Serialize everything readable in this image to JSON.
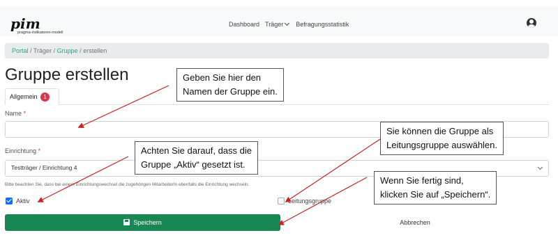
{
  "header": {
    "logo_text": "pim",
    "logo_subtitle": "pragma-indikatoren-modell",
    "nav": [
      "Dashboard",
      "Träger",
      "Befragungsstatistik"
    ]
  },
  "breadcrumb": {
    "items": [
      "Portal",
      "Träger",
      "Gruppe",
      "erstellen"
    ],
    "separator": "/"
  },
  "page": {
    "title": "Gruppe erstellen",
    "tab_label": "Allgemein",
    "tab_badge": "1"
  },
  "form": {
    "name_label": "Name",
    "required_mark": "*",
    "name_value": "",
    "einrichtung_label": "Einrichtung",
    "einrichtung_value": "Testträger / Einrichtung 4",
    "hint": "Bitte beachten Sie, dass bei einem Einrichtungswechsel die zugehörigen MitarbeiterIn ebenfalls die Einrichtung wechseln.",
    "aktiv_label": "Aktiv",
    "aktiv_checked": true,
    "leitung_label": "Leitungsgruppe",
    "leitung_checked": false,
    "save_label": "Speichern",
    "cancel_label": "Abbrechen"
  },
  "callouts": {
    "name": [
      "Geben Sie hier den",
      "Namen der Gruppe ein."
    ],
    "aktiv": [
      "Achten Sie darauf, dass die",
      "Gruppe „Aktiv“ gesetzt ist."
    ],
    "leitung": [
      "Sie können die Gruppe als",
      "Leitungsgruppe auswählen."
    ],
    "save": [
      "Wenn Sie fertig sind,",
      "klicken Sie auf „Speichern“."
    ]
  },
  "colors": {
    "brand_green": "#198754",
    "link_green": "#2aa27a",
    "badge_red": "#dc3545",
    "arrow_red": "#cc2222",
    "checkbox_blue": "#0d6efd"
  }
}
